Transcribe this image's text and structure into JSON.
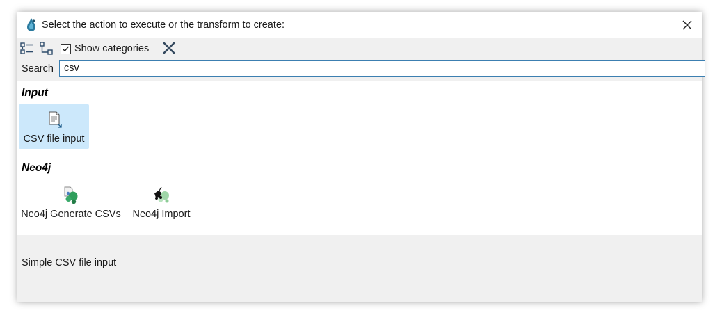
{
  "window": {
    "title": "Select the action to execute or the transform to create:",
    "app_icon": "hop-icon",
    "close_icon": "close-icon"
  },
  "toolbar": {
    "expand_icon": "list-view-icon",
    "tree_icon": "tree-view-icon",
    "show_categories_label": "Show categories",
    "show_categories_checked": true,
    "clear_icon": "clear-icon"
  },
  "search": {
    "label": "Search",
    "value": "csv"
  },
  "categories": [
    {
      "name": "Input",
      "items": [
        {
          "label": "CSV file input",
          "icon": "csv-file-input-icon",
          "selected": true
        }
      ]
    },
    {
      "name": "Neo4j",
      "items": [
        {
          "label": "Neo4j Generate CSVs",
          "icon": "neo4j-generate-csvs-icon",
          "selected": false
        },
        {
          "label": "Neo4j Import",
          "icon": "neo4j-import-icon",
          "selected": false
        }
      ]
    }
  ],
  "description": {
    "text": "Simple CSV file input"
  },
  "colors": {
    "selection": "#cce8fb",
    "panel": "#f0f0f0",
    "input_border": "#3c7fb1"
  }
}
